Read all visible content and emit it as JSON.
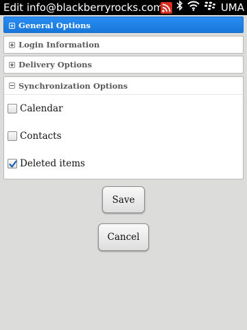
{
  "titlebar": {
    "title": "Edit info@blackberryrocks.com",
    "network": "UMA",
    "icons": [
      "rss-icon",
      "bluetooth-icon",
      "wifi-icon",
      "blackberry-icon"
    ]
  },
  "sections": {
    "general": {
      "label": "General Options",
      "expanded": false,
      "selected": true
    },
    "login": {
      "label": "Login Information",
      "expanded": false
    },
    "delivery": {
      "label": "Delivery Options",
      "expanded": false
    },
    "sync": {
      "label": "Synchronization Options",
      "expanded": true,
      "options": [
        {
          "label": "Calendar",
          "checked": false
        },
        {
          "label": "Contacts",
          "checked": false
        },
        {
          "label": "Deleted items",
          "checked": true
        }
      ]
    }
  },
  "buttons": {
    "save": "Save",
    "cancel": "Cancel"
  },
  "colors": {
    "selection": "#1877d9",
    "background": "#dcdcda",
    "rss": "#d62d20"
  }
}
